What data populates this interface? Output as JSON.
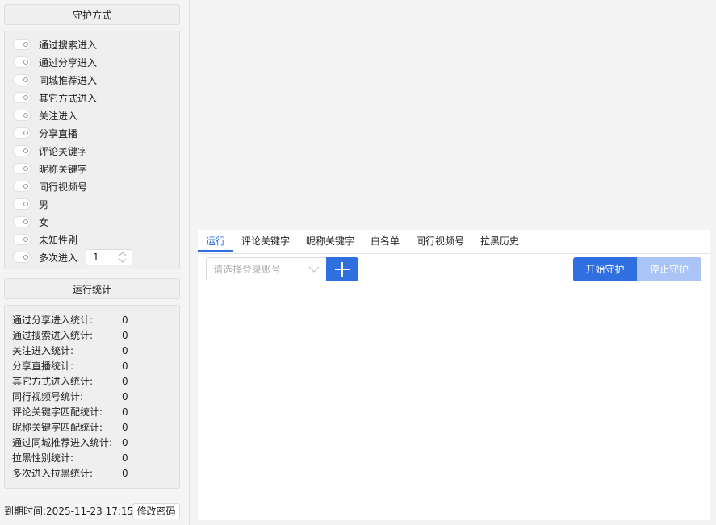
{
  "guard_section": {
    "title": "守护方式"
  },
  "options": [
    {
      "label": "通过搜索进入"
    },
    {
      "label": "通过分享进入"
    },
    {
      "label": "同城推荐进入"
    },
    {
      "label": "其它方式进入"
    },
    {
      "label": "关注进入"
    },
    {
      "label": "分享直播"
    },
    {
      "label": "评论关键字"
    },
    {
      "label": "昵称关键字"
    },
    {
      "label": "同行视频号"
    },
    {
      "label": "男"
    },
    {
      "label": "女"
    },
    {
      "label": "未知性别"
    },
    {
      "label": "多次进入",
      "spin_value": "1"
    }
  ],
  "stats_section": {
    "title": "运行统计"
  },
  "stats": [
    {
      "label": "通过分享进入统计:",
      "value": "0"
    },
    {
      "label": "通过搜索进入统计:",
      "value": "0"
    },
    {
      "label": "关注进入统计:",
      "value": "0"
    },
    {
      "label": "分享直播统计:",
      "value": "0"
    },
    {
      "label": "其它方式进入统计:",
      "value": "0"
    },
    {
      "label": "同行视频号统计:",
      "value": "0"
    },
    {
      "label": "评论关键字匹配统计:",
      "value": "0"
    },
    {
      "label": "昵称关键字匹配统计:",
      "value": "0"
    },
    {
      "label": "通过同城推荐进入统计:",
      "value": "0"
    },
    {
      "label": "拉黑性别统计:",
      "value": "0"
    },
    {
      "label": "多次进入拉黑统计:",
      "value": "0"
    }
  ],
  "footer": {
    "expire_text": "到期时间:2025-11-23 17:15",
    "change_password": "修改密码"
  },
  "tabs": [
    {
      "label": "运行",
      "active": true
    },
    {
      "label": "评论关键字"
    },
    {
      "label": "昵称关键字"
    },
    {
      "label": "白名单"
    },
    {
      "label": "同行视频号"
    },
    {
      "label": "拉黑历史"
    }
  ],
  "toolbar": {
    "account_placeholder": "请选择登录账号",
    "add_icon": "plus-icon",
    "start_label": "开始守护",
    "stop_label": "停止守护"
  },
  "colors": {
    "accent": "#2f6fe0",
    "accent_disabled": "#a9c4f5"
  }
}
